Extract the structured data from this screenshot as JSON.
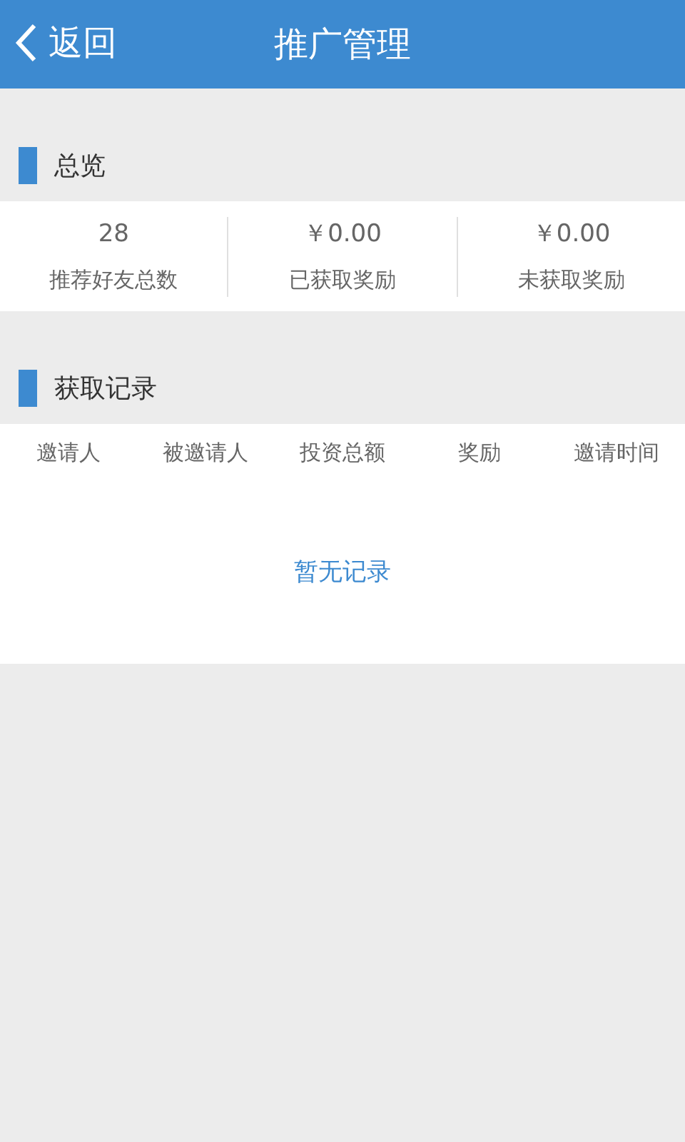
{
  "header": {
    "back": "返回",
    "title": "推广管理"
  },
  "overview": {
    "title": "总览",
    "stats": [
      {
        "value": "28",
        "label": "推荐好友总数"
      },
      {
        "value": "￥0.00",
        "label": "已获取奖励"
      },
      {
        "value": "￥0.00",
        "label": "未获取奖励"
      }
    ]
  },
  "records": {
    "title": "获取记录",
    "columns": [
      "邀请人",
      "被邀请人",
      "投资总额",
      "奖励",
      "邀请时间"
    ],
    "empty": "暂无记录"
  }
}
